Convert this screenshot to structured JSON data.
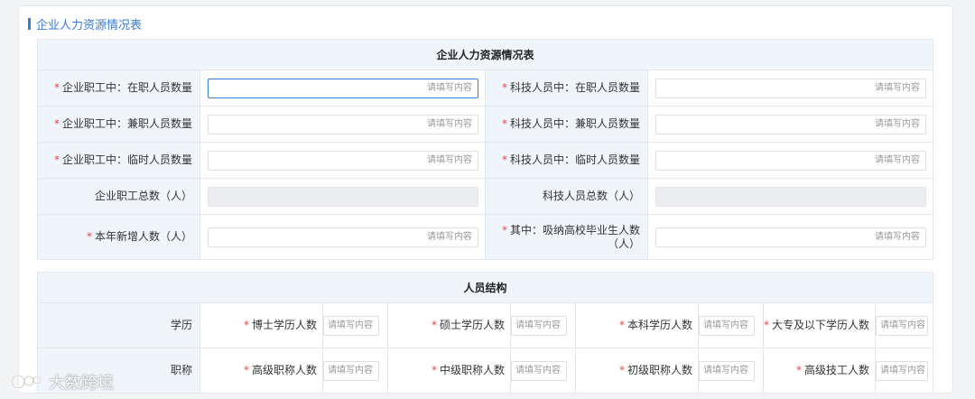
{
  "section": {
    "title": "企业人力资源情况表"
  },
  "table1": {
    "header": "企业人力资源情况表",
    "rows": [
      {
        "left": {
          "label": "企业职工中：在职人员数量",
          "required": "*",
          "placeholder": "请填写内容"
        },
        "right": {
          "label": "科技人员中：在职人员数量",
          "required": "*",
          "placeholder": "请填写内容"
        }
      },
      {
        "left": {
          "label": "企业职工中：兼职人员数量",
          "required": "*",
          "placeholder": "请填写内容"
        },
        "right": {
          "label": "科技人员中：兼职人员数量",
          "required": "*",
          "placeholder": "请填写内容"
        }
      },
      {
        "left": {
          "label": "企业职工中：临时人员数量",
          "required": "*",
          "placeholder": "请填写内容"
        },
        "right": {
          "label": "科技人员中：临时人员数量",
          "required": "*",
          "placeholder": "请填写内容"
        }
      },
      {
        "left": {
          "label": "企业职工总数（人）"
        },
        "right": {
          "label": "科技人员总数（人）"
        }
      },
      {
        "left": {
          "label": "本年新增人数（人）",
          "required": "*",
          "placeholder": "请填写内容"
        },
        "right": {
          "label": "其中：吸纳高校毕业生人数（人）",
          "required": "*",
          "placeholder": "请填写内容"
        }
      }
    ]
  },
  "table2": {
    "header": "人员结构",
    "education": {
      "label": "学历",
      "items": [
        {
          "label": "博士学历人数",
          "required": "*",
          "placeholder": "请填写内容"
        },
        {
          "label": "硕士学历人数",
          "required": "*",
          "placeholder": "请填写内容"
        },
        {
          "label": "本科学历人数",
          "required": "*",
          "placeholder": "请填写内容"
        },
        {
          "label": "大专及以下学历人数",
          "required": "*",
          "placeholder": "请填写内容"
        }
      ]
    },
    "title_rank": {
      "label": "职称",
      "items": [
        {
          "label": "高级职称人数",
          "required": "*",
          "placeholder": "请填写内容"
        },
        {
          "label": "中级职称人数",
          "required": "*",
          "placeholder": "请填写内容"
        },
        {
          "label": "初级职称人数",
          "required": "*",
          "placeholder": "请填写内容"
        },
        {
          "label": "高级技工人数",
          "required": "*",
          "placeholder": "请填写内容"
        }
      ]
    }
  },
  "watermark": {
    "text": "大数跨境"
  },
  "colors": {
    "accent": "#3a7bd5",
    "required": "#e84545",
    "header_bg": "#f0f5fc"
  }
}
